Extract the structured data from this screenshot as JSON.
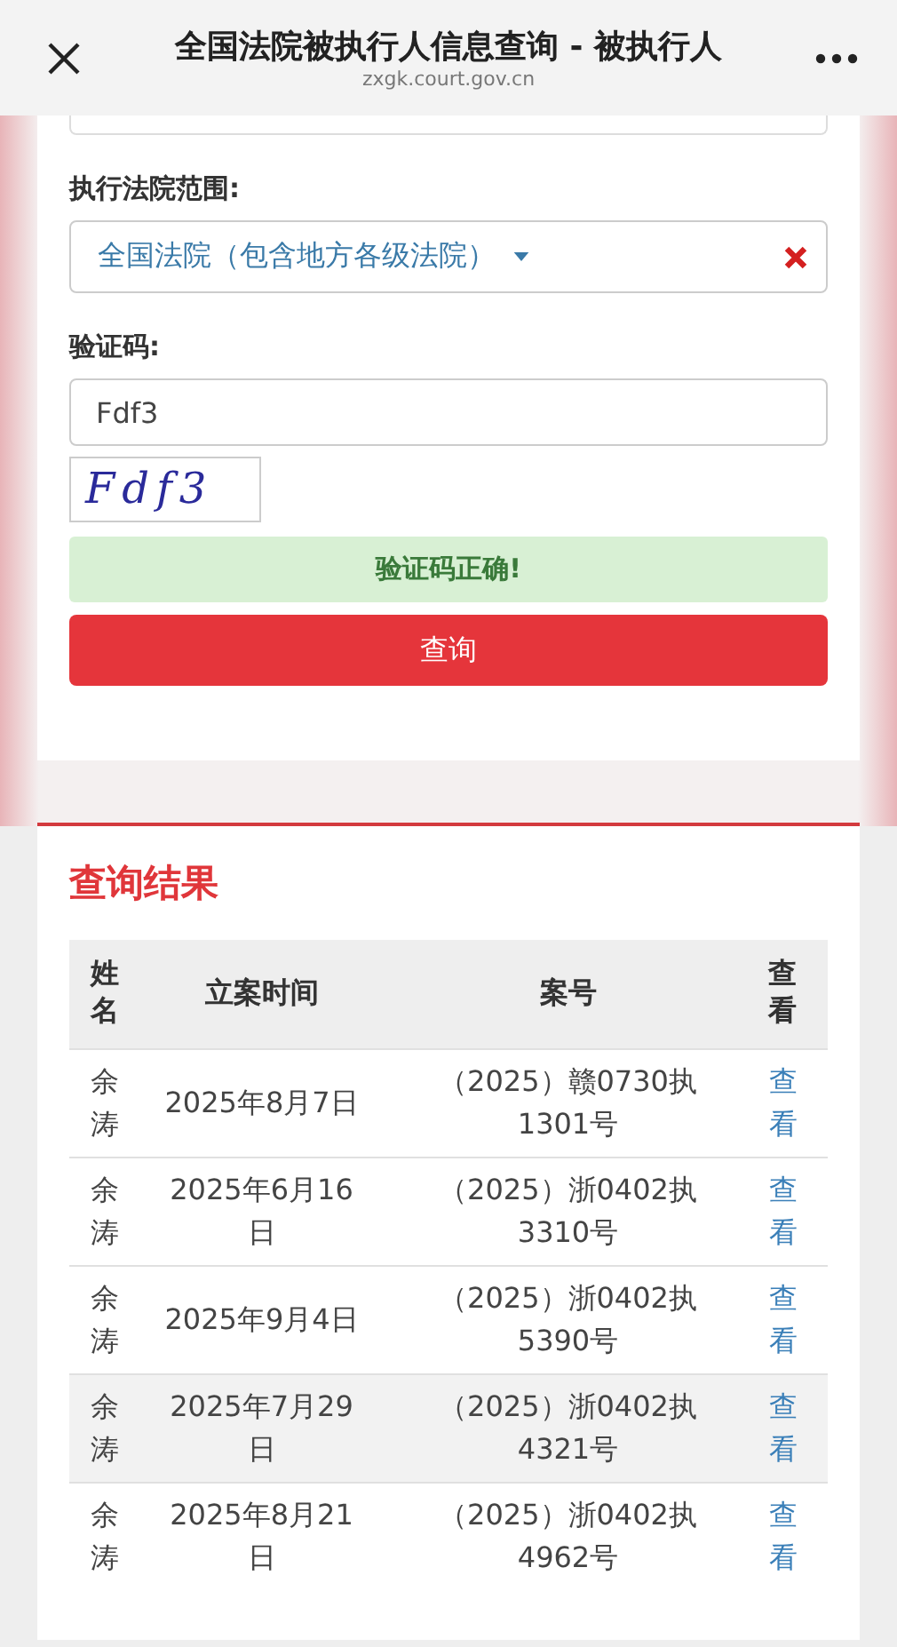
{
  "header": {
    "title": "全国法院被执行人信息查询 - 被执行人",
    "url": "zxgk.court.gov.cn"
  },
  "form": {
    "court_label": "执行法院范围:",
    "court_value": "全国法院（包含地方各级法院）",
    "captcha_label": "验证码:",
    "captcha_value": "Fdf3",
    "captcha_image": "Fdf3",
    "captcha_message": "验证码正确!",
    "submit": "查询"
  },
  "results": {
    "title": "查询结果",
    "columns": [
      "姓名",
      "立案时间",
      "案号",
      "查看"
    ],
    "rows": [
      {
        "name": "余涛",
        "date": "2025年8月7日",
        "case": "（2025）赣0730执1301号",
        "view": "查看",
        "selected": false
      },
      {
        "name": "余涛",
        "date": "2025年6月16日",
        "case": "（2025）浙0402执3310号",
        "view": "查看",
        "selected": false
      },
      {
        "name": "余涛",
        "date": "2025年9月4日",
        "case": "（2025）浙0402执5390号",
        "view": "查看",
        "selected": false
      },
      {
        "name": "余涛",
        "date": "2025年7月29日",
        "case": "（2025）浙0402执4321号",
        "view": "查看",
        "selected": true
      },
      {
        "name": "余涛",
        "date": "2025年8月21日",
        "case": "（2025）浙0402执4962号",
        "view": "查看",
        "selected": false
      }
    ]
  }
}
